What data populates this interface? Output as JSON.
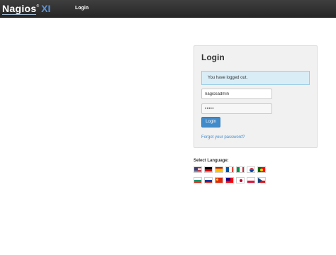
{
  "header": {
    "logo_text": "Nagios",
    "logo_reg": "®",
    "logo_suffix": "XI",
    "nav_login": "Login"
  },
  "login": {
    "title": "Login",
    "alert": "You have logged out.",
    "username_value": "nagiosadmin",
    "password_value": "•••••",
    "button_label": "Login",
    "forgot_label": "Forgot your password?"
  },
  "language": {
    "label": "Select Language:",
    "flags": [
      "us-flag-icon",
      "germany-flag-icon",
      "spain-flag-icon",
      "france-flag-icon",
      "italy-flag-icon",
      "korea-flag-icon",
      "portugal-flag-icon",
      "bulgaria-flag-icon",
      "russia-flag-icon",
      "china-flag-icon",
      "taiwan-flag-icon",
      "japan-flag-icon",
      "poland-flag-icon",
      "czech-flag-icon"
    ]
  },
  "colors": {
    "topbar": "#2f2f2f",
    "accent": "#428bca",
    "alert_bg": "#d9edf7",
    "logo_xi": "#5b93d6"
  }
}
